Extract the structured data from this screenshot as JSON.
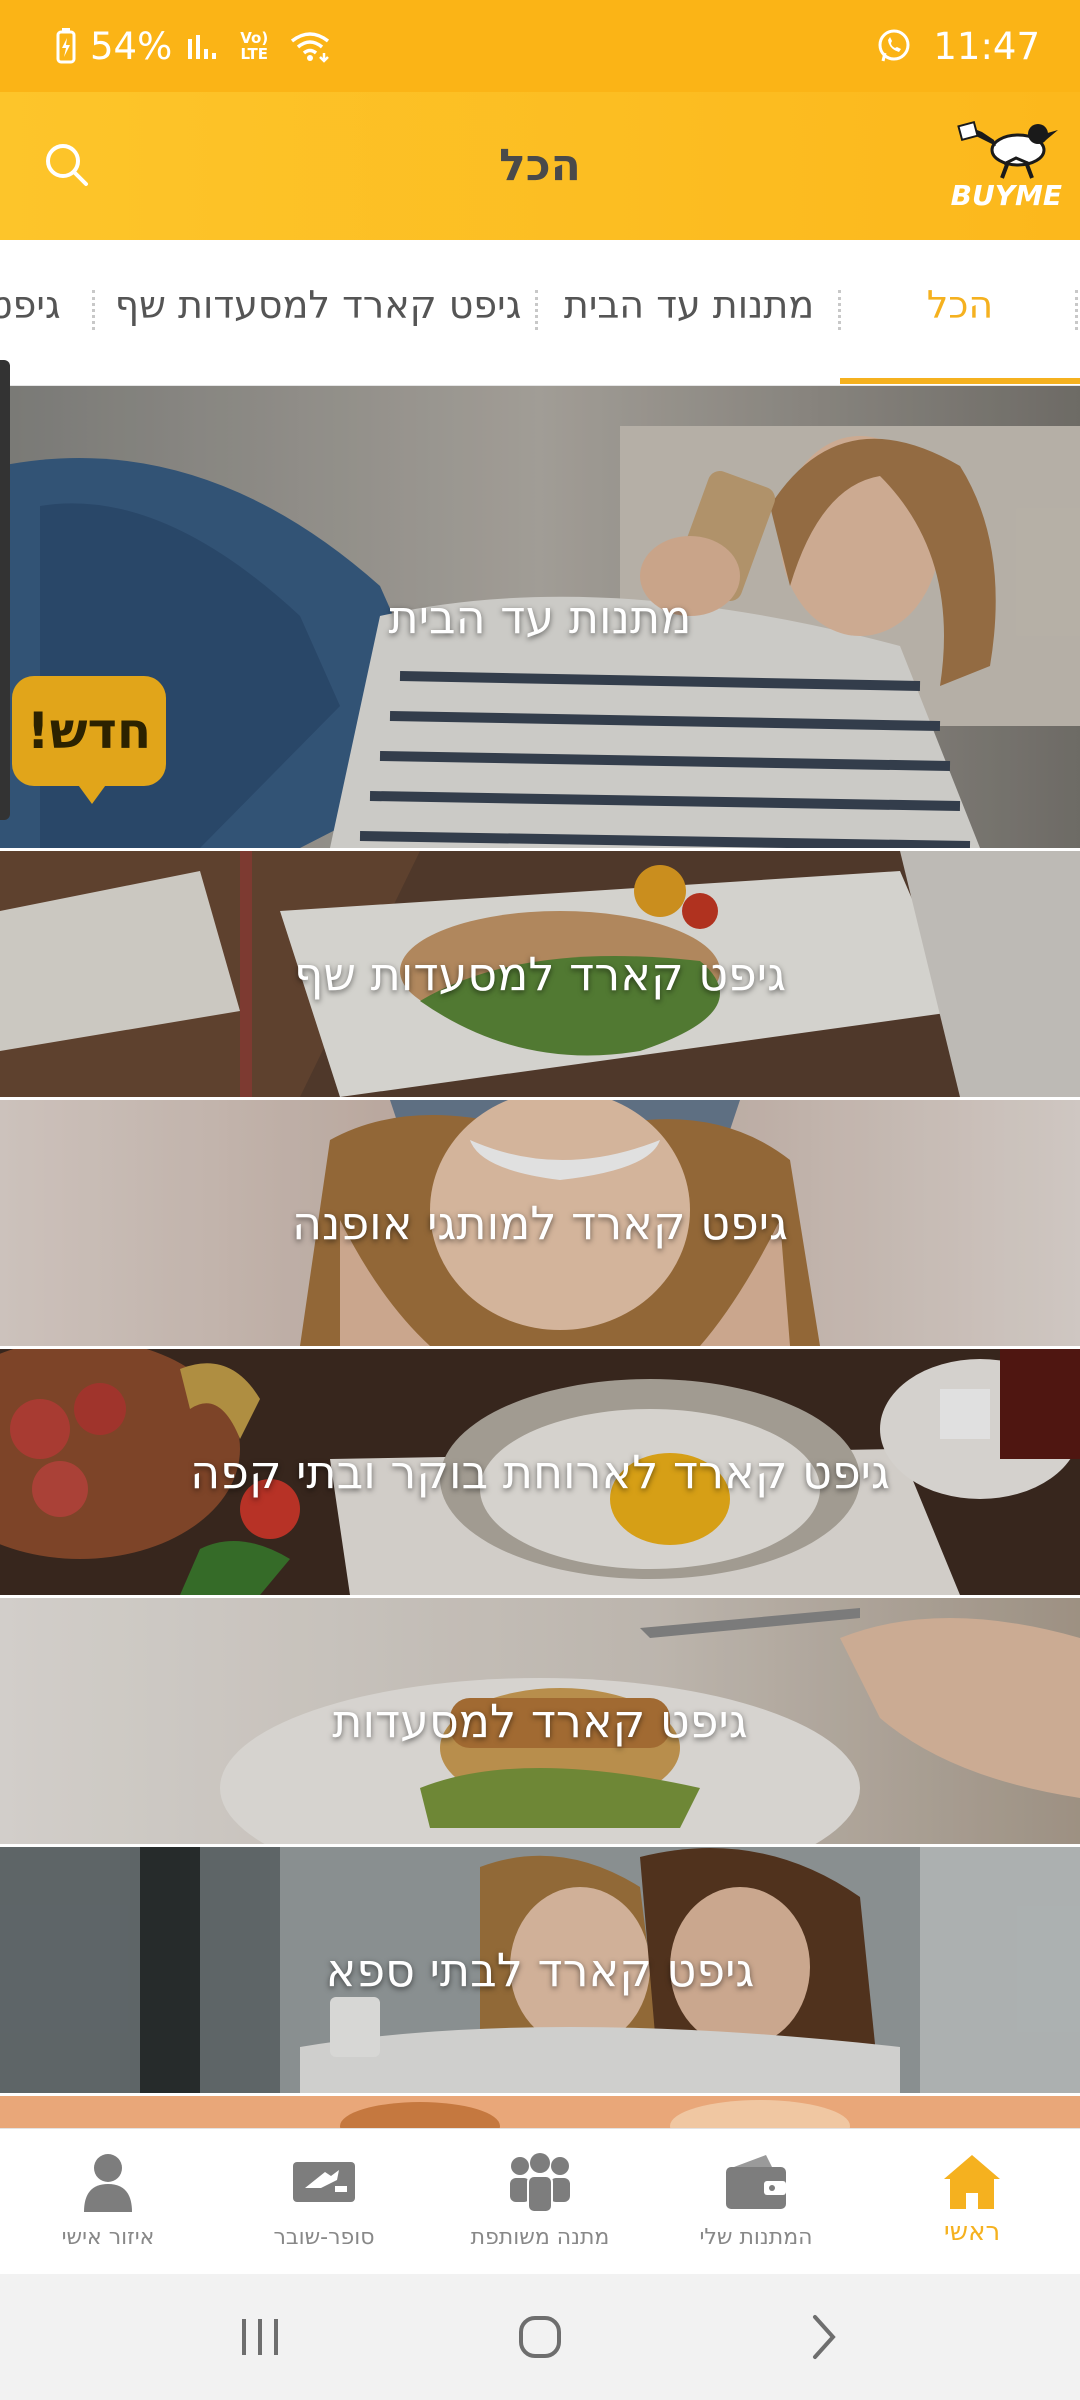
{
  "status_bar": {
    "battery": "54%",
    "signal": "Vo) LTE",
    "time": "11:47"
  },
  "header": {
    "title": "הכל",
    "logo_text": "BUYME",
    "search_icon": "search-icon",
    "brand_color": "#FBB416"
  },
  "tabs": [
    {
      "label": "הכל",
      "active": true
    },
    {
      "label": "מתנות עד הבית",
      "active": false
    },
    {
      "label": "גיפט קארד למסעדות שף",
      "active": false
    },
    {
      "label": "גיפט",
      "active": false
    }
  ],
  "banners": [
    {
      "label": "מתנות עד הבית",
      "badge": "חדש!"
    },
    {
      "label": "גיפט קארד למסעדות שף"
    },
    {
      "label": "גיפט קארד למותגי אופנה"
    },
    {
      "label": "גיפט קארד לארוחת בוקר ובתי קפה"
    },
    {
      "label": "גיפט קארד למסעדות"
    },
    {
      "label": "גיפט קארד לבתי ספא"
    }
  ],
  "bottom_nav": [
    {
      "label": "ראשי",
      "icon": "home-icon",
      "active": true
    },
    {
      "label": "המתנות שלי",
      "icon": "wallet-icon",
      "active": false
    },
    {
      "label": "מתנה משותפת",
      "icon": "group-icon",
      "active": false
    },
    {
      "label": "סופר-שובר",
      "icon": "voucher-icon",
      "active": false
    },
    {
      "label": "איזור אישי",
      "icon": "person-icon",
      "active": false
    }
  ]
}
